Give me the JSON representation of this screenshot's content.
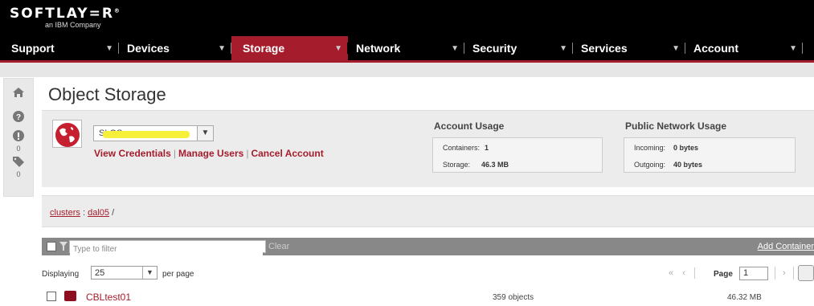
{
  "brand": {
    "logo": "SOFTLAY=R",
    "tagline": "an IBM Company"
  },
  "nav": [
    {
      "label": "Support"
    },
    {
      "label": "Devices"
    },
    {
      "label": "Storage",
      "active": true
    },
    {
      "label": "Network"
    },
    {
      "label": "Security"
    },
    {
      "label": "Services"
    },
    {
      "label": "Account"
    }
  ],
  "sidebar": {
    "alerts_count": "0",
    "tags_count": "0"
  },
  "page": {
    "title": "Object Storage"
  },
  "account": {
    "select_value": "SLOS",
    "links": {
      "view_credentials": "View Credentials",
      "manage_users": "Manage Users",
      "cancel_account": "Cancel Account"
    }
  },
  "account_usage": {
    "heading": "Account Usage",
    "containers_label": "Containers:",
    "containers_value": "1",
    "storage_label": "Storage:",
    "storage_value": "46.3 MB"
  },
  "network_usage": {
    "heading": "Public Network Usage",
    "incoming_label": "Incoming:",
    "incoming_value": "0 bytes",
    "outgoing_label": "Outgoing:",
    "outgoing_value": "40 bytes"
  },
  "breadcrumb": {
    "clusters": "clusters",
    "sep": ":",
    "location": "dal05",
    "tail": "/"
  },
  "filter": {
    "placeholder": "Type to filter",
    "clear_label": "Clear",
    "add_label": "Add Container"
  },
  "paging": {
    "displaying_label": "Displaying",
    "per_page_value": "25",
    "per_page_label": "per page",
    "page_label": "Page",
    "page_value": "1"
  },
  "rows": [
    {
      "name": "CBLtest01",
      "objects": "359 objects",
      "size": "46.32 MB"
    }
  ],
  "colors": {
    "accent": "#a51d2d",
    "topbar": "#000000"
  }
}
